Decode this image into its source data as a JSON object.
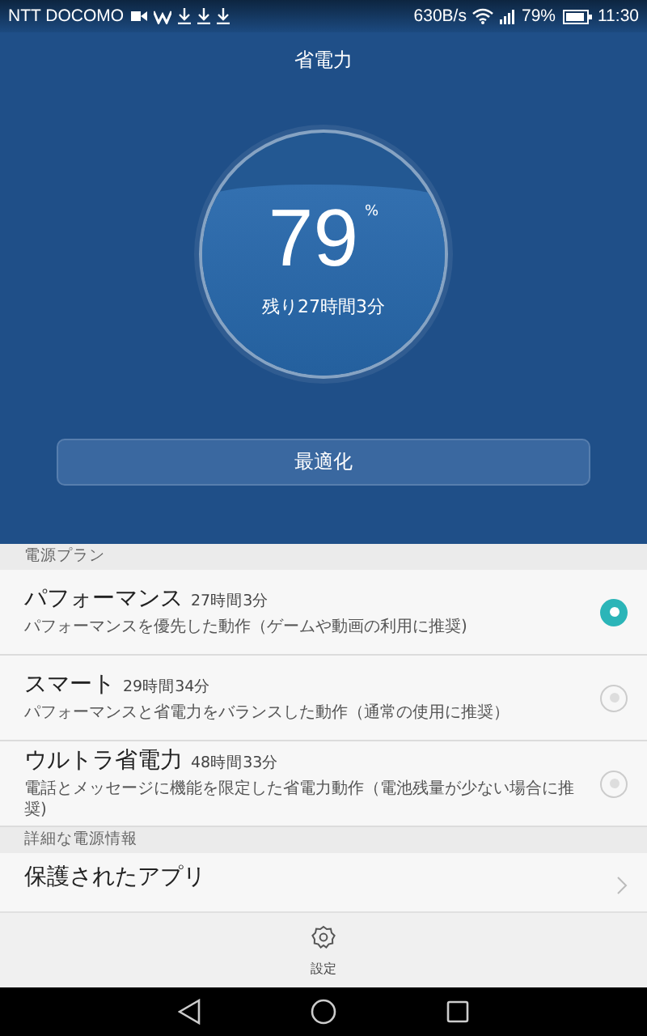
{
  "status_bar": {
    "carrier": "NTT DOCOMO",
    "speed": "630B/s",
    "battery": "79%",
    "time": "11:30"
  },
  "header": {
    "title": "省電力",
    "gauge": {
      "value": "79",
      "unit": "%",
      "remaining": "残り27時間3分"
    },
    "optimize_button": "最適化"
  },
  "sections": [
    {
      "title": "電源プラン",
      "items": [
        {
          "kind": "radio",
          "title": "パフォーマンス",
          "time": "27時間3分",
          "description": "パフォーマンスを優先した動作（ゲームや動画の利用に推奨)",
          "selected": true
        },
        {
          "kind": "radio",
          "title": "スマート",
          "time": "29時間34分",
          "description": "パフォーマンスと省電力をバランスした動作（通常の使用に推奨）",
          "selected": false
        },
        {
          "kind": "radio",
          "title": "ウルトラ省電力",
          "time": "48時間33分",
          "description": "電話とメッセージに機能を限定した省電力動作（電池残量が少ない場合に推奨)",
          "selected": false
        }
      ]
    },
    {
      "title": "詳細な電源情報",
      "items": [
        {
          "kind": "link",
          "title": "保護されたアプリ"
        }
      ]
    }
  ],
  "bottom_bar": {
    "settings": "設定"
  }
}
